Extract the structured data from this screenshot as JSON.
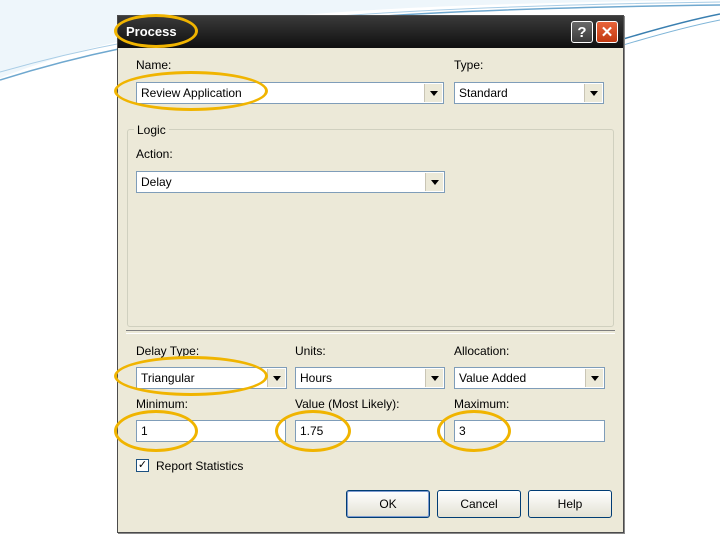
{
  "dialog": {
    "title": "Process",
    "help_glyph": "?",
    "close_glyph": "✕"
  },
  "fields": {
    "name_label": "Name:",
    "name_value": "Review Application",
    "type_label": "Type:",
    "type_value": "Standard",
    "logic_label": "Logic",
    "action_label": "Action:",
    "action_value": "Delay",
    "delay_type_label": "Delay Type:",
    "delay_type_value": "Triangular",
    "units_label": "Units:",
    "units_value": "Hours",
    "allocation_label": "Allocation:",
    "allocation_value": "Value Added",
    "minimum_label": "Minimum:",
    "minimum_value": "1",
    "most_likely_label": "Value (Most Likely):",
    "most_likely_value": "1.75",
    "maximum_label": "Maximum:",
    "maximum_value": "3",
    "report_statistics_label": "Report Statistics",
    "report_statistics_checked": true,
    "check_glyph": "✓"
  },
  "buttons": {
    "ok": "OK",
    "cancel": "Cancel",
    "help": "Help"
  },
  "colors": {
    "highlight_ring": "#f0b400",
    "title_bar": "#1a1a1a",
    "dialog_bg": "#ece9d8"
  }
}
